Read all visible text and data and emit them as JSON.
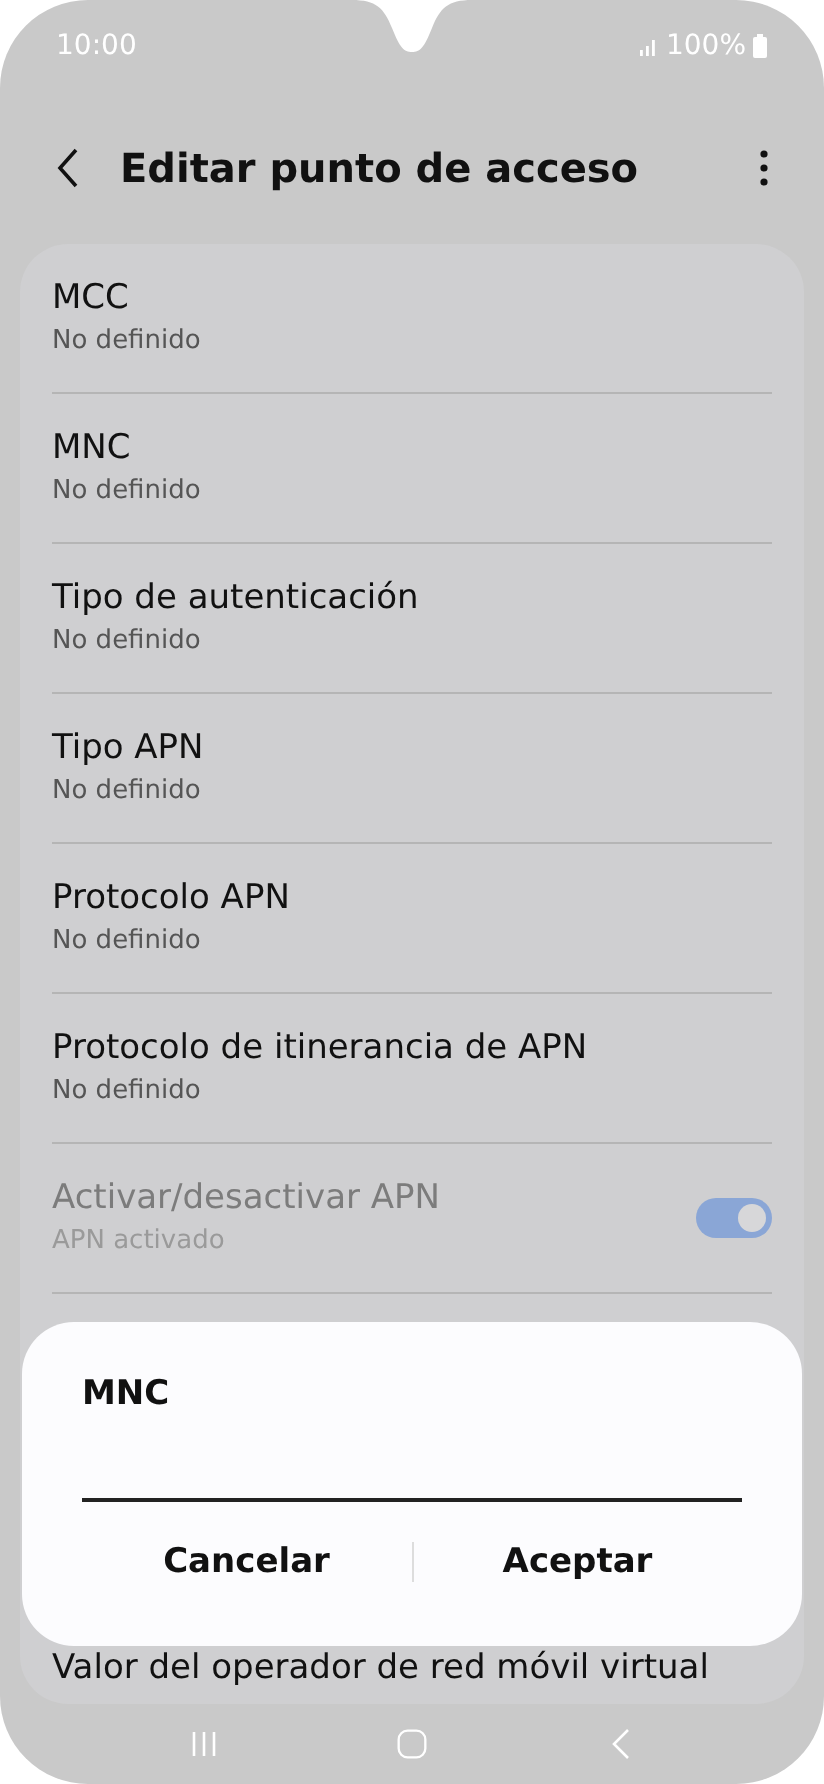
{
  "status_bar": {
    "time": "10:00",
    "battery": "100%"
  },
  "header": {
    "title": "Editar punto de acceso"
  },
  "settings": [
    {
      "kind": "text",
      "title": "MCC",
      "subtitle": "No definido"
    },
    {
      "kind": "text",
      "title": "MNC",
      "subtitle": "No definido"
    },
    {
      "kind": "text",
      "title": "Tipo de autenticación",
      "subtitle": "No definido"
    },
    {
      "kind": "text",
      "title": "Tipo APN",
      "subtitle": "No definido"
    },
    {
      "kind": "text",
      "title": "Protocolo APN",
      "subtitle": "No definido"
    },
    {
      "kind": "text",
      "title": "Protocolo de itinerancia de APN",
      "subtitle": "No definido"
    },
    {
      "kind": "toggle",
      "title": "Activar/desactivar APN",
      "subtitle": "APN activado",
      "on": true,
      "disabled": true
    }
  ],
  "partial_item": {
    "title": "Valor del operador de red móvil virtual"
  },
  "dialog": {
    "title": "MNC",
    "buttons": [
      "Cancelar",
      "Aceptar"
    ]
  }
}
